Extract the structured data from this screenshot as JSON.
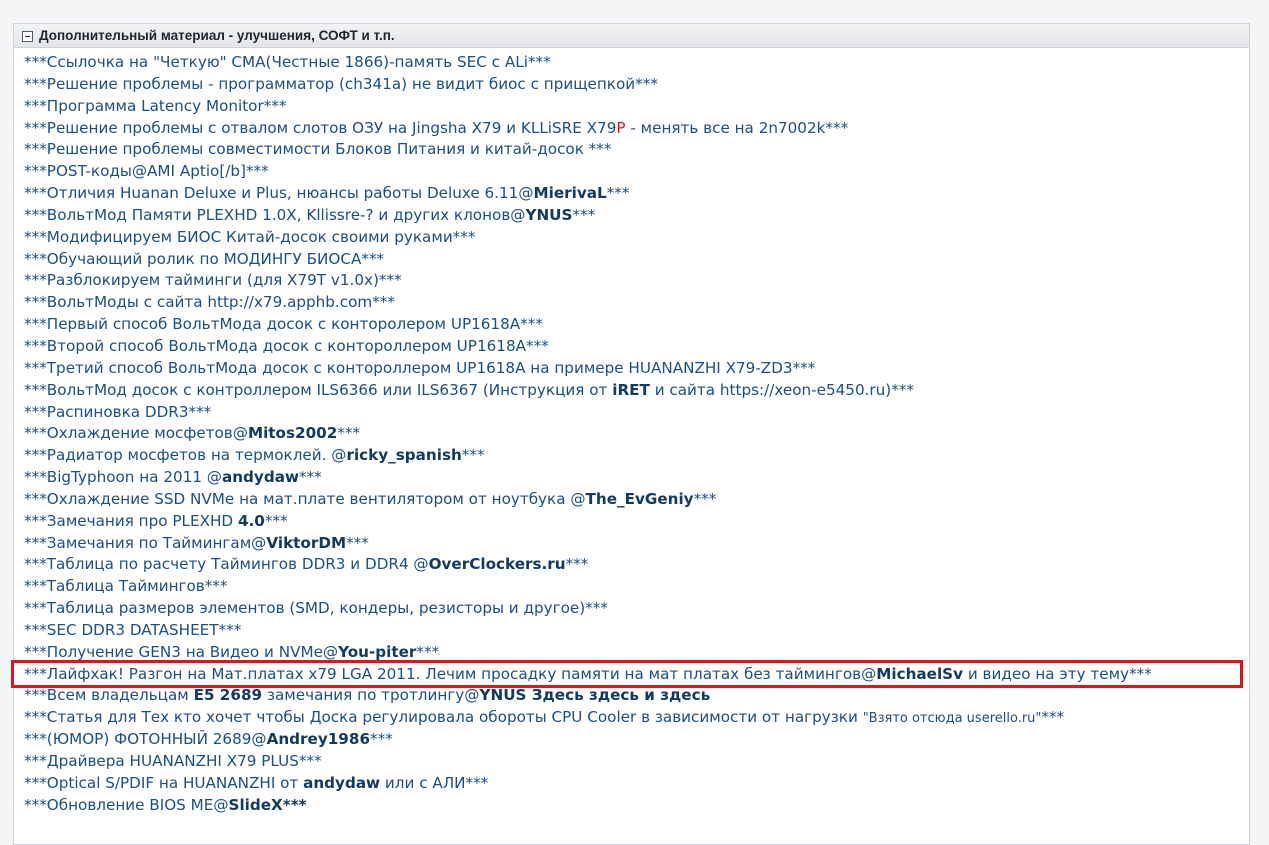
{
  "panel": {
    "title": "Дополнительный материал - улучшения, СОФТ и т.п."
  },
  "colors": {
    "link": "#1c4f86",
    "highlight_border": "#e0141c",
    "red_letter": "#e0151c"
  },
  "items": [
    "***Ссылочка на \"Четкую\" CMA(Честные 1866)-память SEC с ALi***",
    "***Решение проблемы - программатор (ch341a) не видит биос с прищепкой***",
    "***Программа Latency Monitor***",
    {
      "a": "***Решение проблемы с отвалом слотов ОЗУ на Jingsha X79 и KLLiSRE X79",
      "b": "P",
      "c": " - менять все на 2n7002k***"
    },
    "***Решение проблемы совместимости Блоков Питания и китай-досок ***",
    "***POST-коды@AMI Aptio[/b]***",
    {
      "a": "***Отличия Huanan Deluxe и Plus, нюансы работы Deluxe 6.11@",
      "b": "MierivaL",
      "c": "***"
    },
    {
      "a": "***ВольтМод Памяти PLEXHD 1.0X, Kllissre-? и других клонов@",
      "b": "YNUS",
      "c": "***"
    },
    "***Модифицируем БИОС Китай-досок своими руками***",
    "***Обучающий ролик по МОДИНГУ БИОСА***",
    "***Разблокируем тайминги (для X79T v1.0x)***",
    "***ВольтМоды с сайта http://x79.apphb.com***",
    "***Первый способ ВольтМода досок с конторолером UP1618A***",
    "***Второй способ ВольтМода досок с контороллером UP1618A***",
    "***Третий способ ВольтМода досок с контороллером UP1618A на примере HUANANZHI X79-ZD3***",
    {
      "a": "***ВольтМод досок с контроллером ILS6366 или ILS6367 (Инструкция от ",
      "b": "iRET",
      "c": " и сайта https://xeon-e5450.ru)***"
    },
    "***Распиновка DDR3***",
    {
      "a": "***Охлаждение мосфетов@",
      "b": "Mitos2002",
      "c": "***"
    },
    {
      "a": "***Радиатор мосфетов на термоклей. @",
      "b": "ricky_spanish",
      "c": "***"
    },
    {
      "a": "***BigTyphoon на 2011 @",
      "b": "andydaw",
      "c": "***"
    },
    {
      "a": "***Охлаждение SSD NVMe на мат.плате вентилятором от ноутбука @",
      "b": "The_EvGeniy",
      "c": "***"
    },
    {
      "a": "***Замечания про PLEXHD ",
      "b": "4.0",
      "c": "***"
    },
    {
      "a": "***Замечания по Таймингам@",
      "b": "ViktorDM",
      "c": "***"
    },
    {
      "a": "***Таблица по расчету Таймингов DDR3 и DDR4 @",
      "b": "OverClockers.ru",
      "c": "***"
    },
    "***Таблица Таймингов***",
    "***Таблица размеров элементов (SMD, кондеры, резисторы и другое)***",
    "***SEC DDR3 DATASHEET***",
    {
      "a": "***Получение GEN3 на Видео и NVMe@",
      "b": "You-piter",
      "c": "***"
    },
    {
      "a": "***Лайфхак! Разгон на Мат.платах x79 LGA 2011. Лечим просадку памяти на мат платах без таймингов@",
      "b": "MichaelSv",
      "c": " и видео на эту тему***"
    },
    {
      "a": "***Всем владельцам ",
      "b": "E5 2689",
      "c": " замечания по тротлингу@",
      "d": "YNUS Здесь здесь и здесь"
    },
    {
      "a": "***Статья для Тех кто хочет чтобы Доска регулировала обороты CPU Cooler в зависимости от нагрузки ",
      "s": "\"Взято отсюда userello.ru\"",
      "c": "***"
    },
    {
      "a": "***(ЮМОР) ФОТОННЫЙ 2689@",
      "b": "Andrey1986",
      "c": "***"
    },
    "***Драйвера HUANANZHI X79 PLUS***",
    {
      "a": "***Optical S/PDIF на HUANANZHI от ",
      "b": "andydaw",
      "c": " или с АЛИ***"
    },
    {
      "a": "***Обновление BIOS ME@",
      "b": "SlideX***"
    }
  ]
}
